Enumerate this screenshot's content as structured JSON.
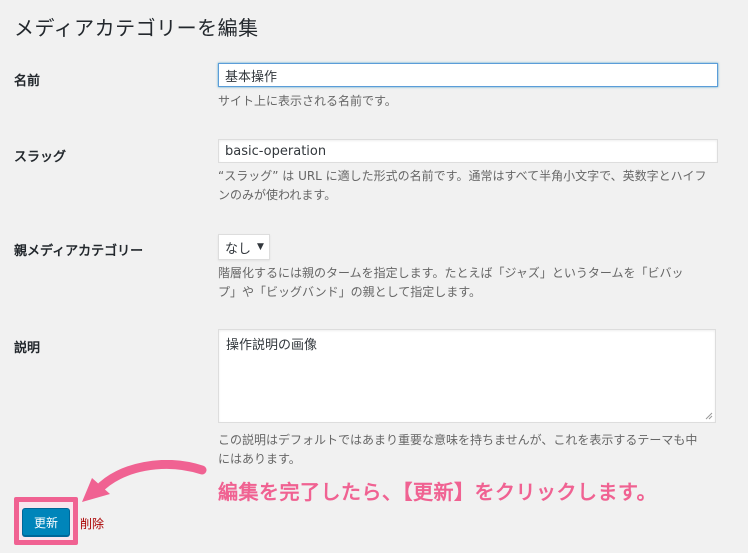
{
  "page": {
    "title": "メディアカテゴリーを編集"
  },
  "fields": {
    "name": {
      "label": "名前",
      "value": "基本操作",
      "description": "サイト上に表示される名前です。"
    },
    "slug": {
      "label": "スラッグ",
      "value": "basic-operation",
      "description_line1": "“スラッグ” は URL に適した形式の名前です。通常はすべて半角小文字で、英数字とハイフ",
      "description_line2": "ンのみが使われます。"
    },
    "parent": {
      "label": "親メディアカテゴリー",
      "selected": "なし",
      "description_line1": "階層化するには親のタームを指定します。たとえば「ジャズ」というタームを「ビバッ",
      "description_line2": "プ」や「ビッグバンド」の親として指定します。"
    },
    "description": {
      "label": "説明",
      "value": "操作説明の画像",
      "description_line1": "この説明はデフォルトではあまり重要な意味を持ちませんが、これを表示するテーマも中",
      "description_line2": "にはあります。"
    }
  },
  "actions": {
    "update_label": "更新",
    "delete_label": "削除"
  },
  "annotation": {
    "text": "編集を完了したら、【更新】をクリックします。",
    "color": "#f06292"
  },
  "colors": {
    "primary_button": "#0085ba",
    "delete_link": "#aa0000",
    "background": "#f1f1f1"
  }
}
